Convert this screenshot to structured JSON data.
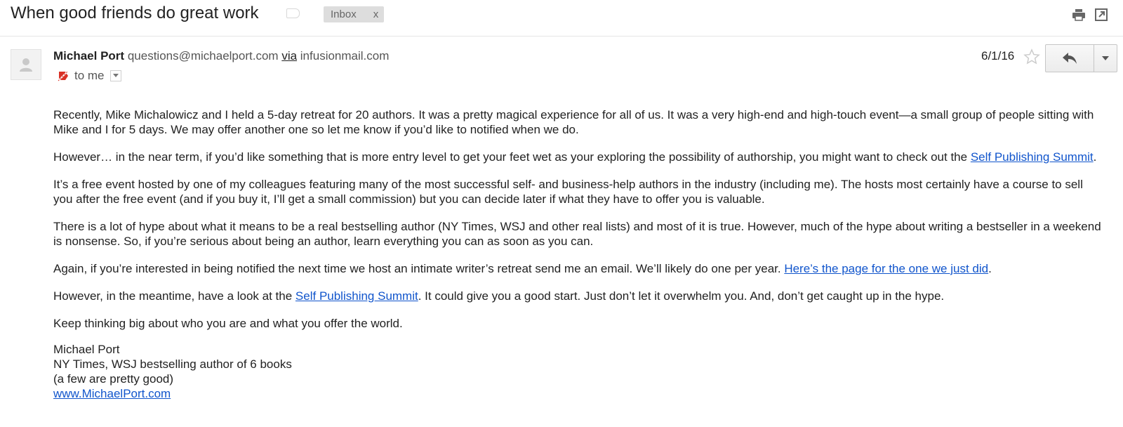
{
  "subject": "When good friends do great work",
  "label": {
    "name": "Inbox",
    "remove": "x"
  },
  "sender": {
    "name": "Michael Port",
    "email": "questions@michaelport.com",
    "via": "via",
    "via_domain": "infusionmail.com",
    "to": "to me"
  },
  "date": "6/1/16",
  "icons": {
    "print": "print-icon",
    "popout": "new-window-icon",
    "avatar": "person-icon",
    "importance": "importance-marker-icon",
    "star": "star-icon",
    "reply": "reply-arrow-icon",
    "more": "triangle-down-icon"
  },
  "body": {
    "p1": "Recently, Mike Michalowicz and I held a 5-day retreat for 20 authors. It was a pretty magical experience for all of us. It was a very high-end and high-touch event—a small group of people sitting with Mike and I for 5 days. We may offer another one so let me know if you’d like to notified when we do.",
    "p2_text": "However… in the near term, if you’d like something that is more entry level to get your feet wet as your exploring the possibility of authorship, you might want to check out the ",
    "p2_link": "Self Publishing Summit",
    "p2_end": ".",
    "p3": "It’s a free event hosted by one of my colleagues featuring many of the most successful self- and business-help authors in the industry (including me). The hosts most certainly have a course to sell you after the free event (and if you buy it, I’ll get a small commission) but you can decide later if what they have to offer you is valuable.",
    "p4": "There is a lot of hype about what it means to be a real bestselling author (NY Times, WSJ and other real lists) and most of it is true. However, much of the hype about writing a bestseller in a weekend is nonsense. So, if you’re serious about being an author, learn everything you can as soon as you can.",
    "p5_text": "Again, if you’re interested in being notified the next time we host an intimate writer’s retreat send me an email. We’ll likely do one per year. ",
    "p5_link": "Here’s the page for the one we just did",
    "p5_end": ".",
    "p6_text": "However, in the meantime, have a look at the ",
    "p6_link": "Self Publishing Summit",
    "p6_end": ". It could give you a good start. Just don’t let it overwhelm you. And, don’t get caught up in the hype.",
    "p7": "Keep thinking big about who you are and what you offer the world."
  },
  "signature": {
    "name": "Michael Port",
    "title": "NY Times, WSJ bestselling author of 6 books",
    "note": "(a few are pretty good)",
    "website": "www.MichaelPort.com"
  },
  "colors": {
    "link": "#1155cc",
    "chip": "#dddddd",
    "importance": "#d93025"
  }
}
